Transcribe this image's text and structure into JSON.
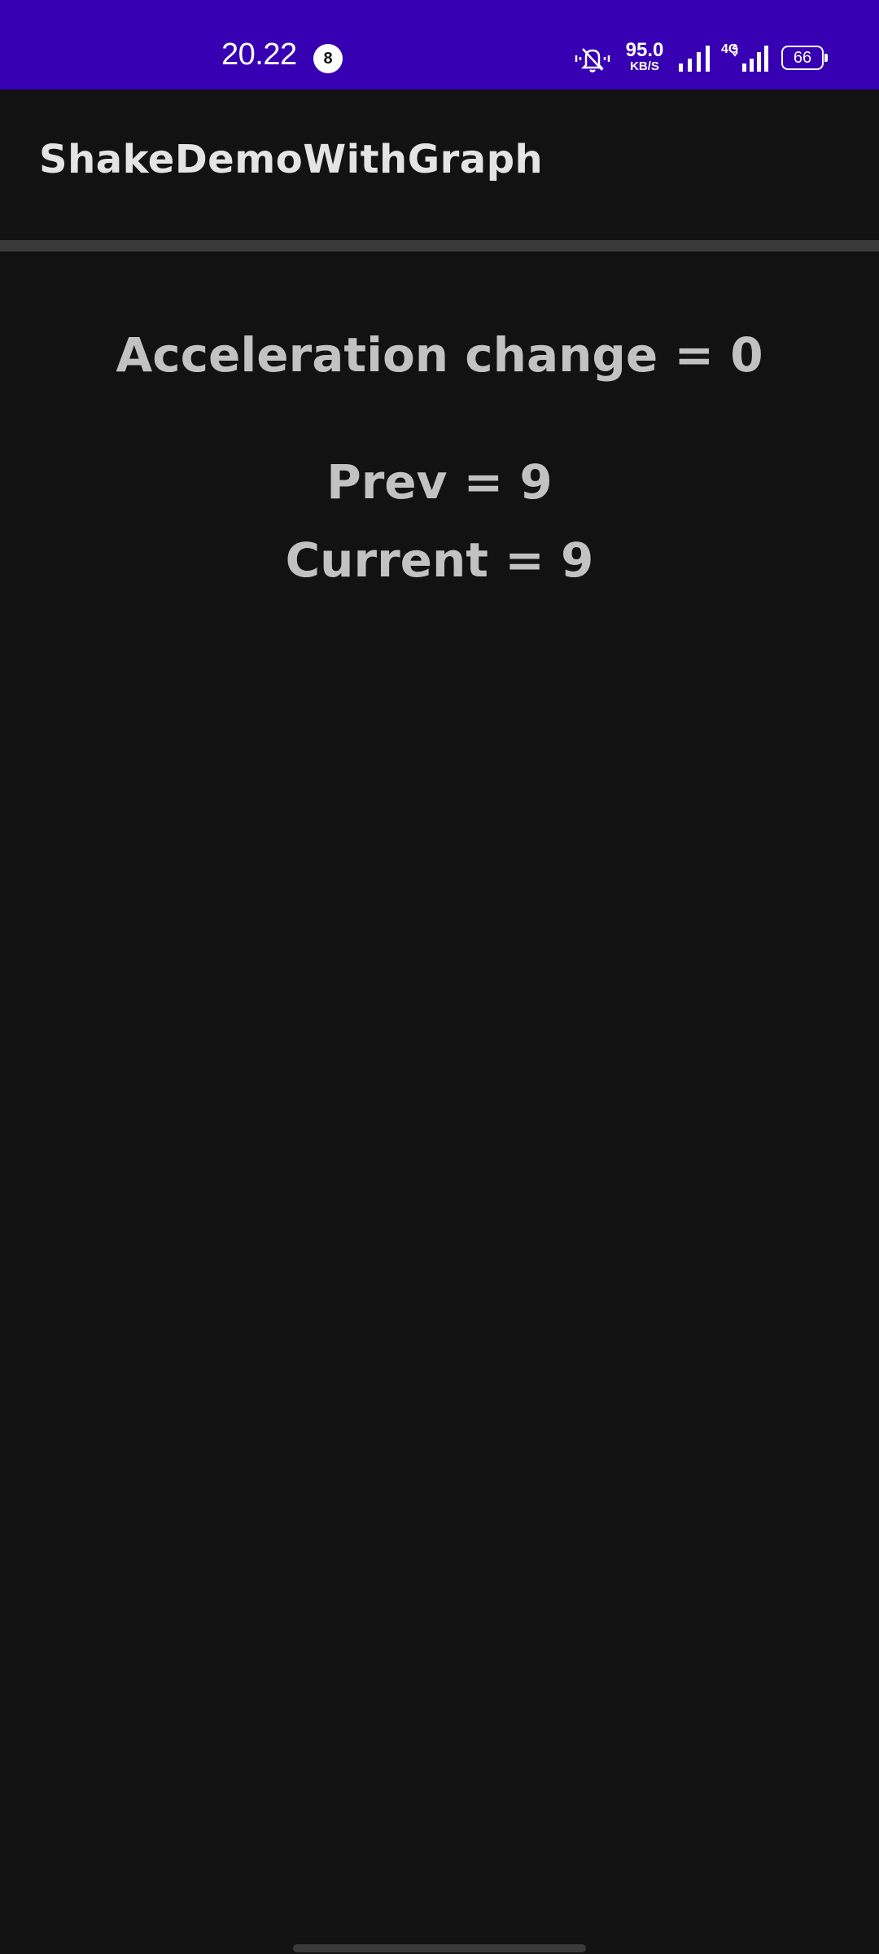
{
  "status_bar": {
    "time": "20.22",
    "notification_count": "8",
    "silent_icon": "silent-bell-icon",
    "net_speed_value": "95.0",
    "net_speed_unit": "KB/S",
    "network_type": "4G",
    "battery_level": "66",
    "background_color": "#3700b3"
  },
  "app_bar": {
    "title": "ShakeDemoWithGraph"
  },
  "main": {
    "acceleration_text": "Acceleration change = 0",
    "prev_text": "Prev = 9",
    "current_text": "Current = 9"
  },
  "colors": {
    "background": "#121212",
    "text": "#c2c2c2",
    "divider": "#3a3a3a"
  }
}
